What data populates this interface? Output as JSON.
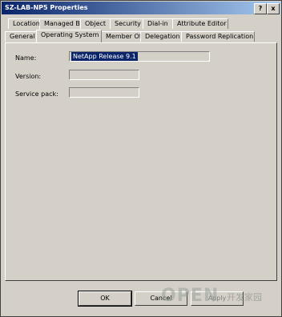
{
  "window": {
    "title": "SZ-LAB-NP5 Properties"
  },
  "titlebar": {
    "help_label": "?",
    "close_label": "x"
  },
  "tabs_top": [
    "Location",
    "Managed By",
    "Object",
    "Security",
    "Dial-in",
    "Attribute Editor"
  ],
  "tabs_bottom": [
    "General",
    "Operating System",
    "Member Of",
    "Delegation",
    "Password Replication"
  ],
  "active_tab": "Operating System",
  "fields": {
    "name_label": "Name:",
    "name_value": "NetApp Release 9.1",
    "version_label": "Version:",
    "version_value": "",
    "service_pack_label": "Service pack:",
    "service_pack_value": ""
  },
  "buttons": {
    "ok": "OK",
    "cancel": "Cancel",
    "apply": "Apply"
  },
  "watermark": {
    "text": "OPEN",
    "cn": "开发家园"
  }
}
